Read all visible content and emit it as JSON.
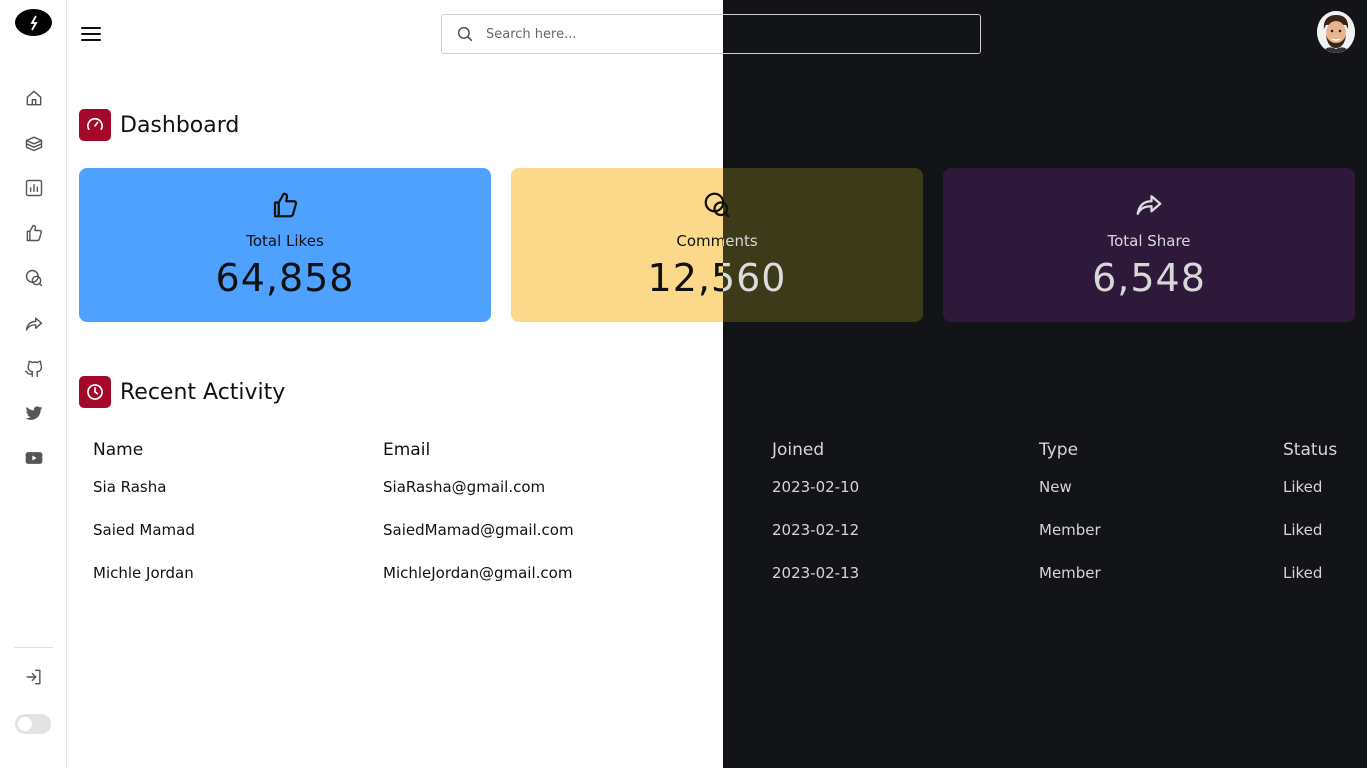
{
  "search": {
    "placeholder": "Search here..."
  },
  "sidebar": {
    "items": [
      {
        "icon": "home-icon"
      },
      {
        "icon": "files-icon"
      },
      {
        "icon": "chart-icon"
      },
      {
        "icon": "thumbs-up-icon"
      },
      {
        "icon": "comments-icon"
      },
      {
        "icon": "share-icon"
      },
      {
        "icon": "github-icon"
      },
      {
        "icon": "twitter-icon"
      },
      {
        "icon": "youtube-icon"
      }
    ],
    "logout_icon": "logout-icon",
    "theme_toggle": "off"
  },
  "dashboard": {
    "title": "Dashboard"
  },
  "cards": [
    {
      "label": "Total Likes",
      "value": "64,858",
      "icon": "thumbs-up-icon",
      "color": "#4ea1ff"
    },
    {
      "label": "Comments",
      "value": "12,560",
      "icon": "comments-icon",
      "color": "#fcd98a"
    },
    {
      "label": "Total Share",
      "value": "6,548",
      "icon": "share-icon",
      "color": "#2e193b"
    }
  ],
  "activity": {
    "title": "Recent Activity",
    "columns": [
      "Name",
      "Email",
      "Joined",
      "Type",
      "Status"
    ],
    "rows": [
      {
        "name": "Sia Rasha",
        "email": "SiaRasha@gmail.com",
        "joined": "2023-02-10",
        "type": "New",
        "status": "Liked"
      },
      {
        "name": "Saied Mamad",
        "email": "SaiedMamad@gmail.com",
        "joined": "2023-02-12",
        "type": "Member",
        "status": "Liked"
      },
      {
        "name": "Michle Jordan",
        "email": "MichleJordan@gmail.com",
        "joined": "2023-02-13",
        "type": "Member",
        "status": "Liked"
      }
    ]
  },
  "colors": {
    "accent": "#a3072a",
    "dark_bg": "#121418"
  }
}
